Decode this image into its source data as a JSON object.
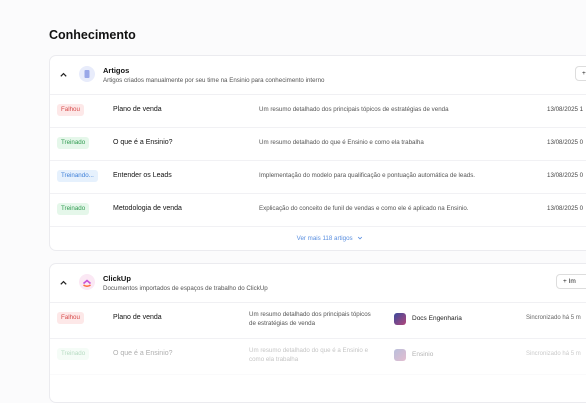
{
  "page": {
    "title": "Conhecimento"
  },
  "sources": [
    {
      "title": "Artigos",
      "description": "Artigos criados manualmente por seu time na Ensinio para conhecimento interno",
      "button_label": "+",
      "rows": [
        {
          "status": "Falhou",
          "title": "Plano de venda",
          "description": "Um resumo detalhado dos principais tópicos de estratégias de venda",
          "date": "13/08/2025 1"
        },
        {
          "status": "Treinado",
          "title": "O que é a Ensinio?",
          "description": "Um resumo detalhado do que é Ensinio e como ela trabalha",
          "date": "13/08/2025 0"
        },
        {
          "status": "Treinando...",
          "title": "Entender os Leads",
          "description": "Implementação do modelo para qualificação e pontuação automática de leads.",
          "date": "13/08/2025 0"
        },
        {
          "status": "Treinado",
          "title": "Metodologia de venda",
          "description": "Explicação do conceito de funil de vendas e como ele é aplicado na Ensinio.",
          "date": "13/08/2025 0"
        }
      ],
      "more_label": "Ver mais 118 artigos"
    },
    {
      "title": "ClickUp",
      "description": "Documentos importados de espaços de trabalho do ClickUp",
      "button_label": "+ Im",
      "rows": [
        {
          "status": "Falhou",
          "title": "Plano de venda",
          "description": "Um resumo detalhado dos principais tópicos de estratégias de venda",
          "workspace": "Docs Engenharia",
          "sync": "Sincronizado há 5 m"
        },
        {
          "status": "Treinado",
          "title": "O que é a Ensinio?",
          "description": "Um resumo detalhado do que é a Ensinio e como ela trabalha",
          "workspace": "Ensinio",
          "sync": "Sincronizado há 5 m"
        }
      ]
    }
  ],
  "colors": {
    "failed": "#d64a4a",
    "trained": "#2e9a4f",
    "training": "#3d7fd8",
    "link": "#5a8fe0"
  }
}
